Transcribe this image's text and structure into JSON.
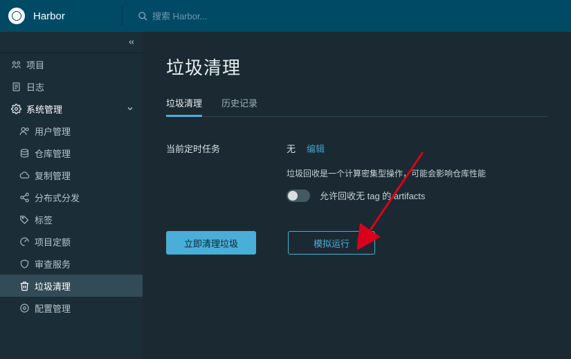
{
  "header": {
    "brand": "Harbor",
    "search_placeholder": "搜索 Harbor..."
  },
  "sidebar": {
    "top": [
      {
        "key": "projects",
        "label": "项目"
      },
      {
        "key": "logs",
        "label": "日志"
      },
      {
        "key": "sysadmin",
        "label": "系统管理",
        "expanded": true
      }
    ],
    "sysadmin_children": [
      {
        "key": "users",
        "label": "用户管理"
      },
      {
        "key": "registries",
        "label": "仓库管理"
      },
      {
        "key": "replication",
        "label": "复制管理"
      },
      {
        "key": "distribution",
        "label": "分布式分发"
      },
      {
        "key": "labels",
        "label": "标签"
      },
      {
        "key": "quotas",
        "label": "项目定额"
      },
      {
        "key": "interrogation",
        "label": "审查服务"
      },
      {
        "key": "gc",
        "label": "垃圾清理",
        "active": true
      },
      {
        "key": "config",
        "label": "配置管理"
      }
    ]
  },
  "main": {
    "title": "垃圾清理",
    "tabs": [
      {
        "key": "gc",
        "label": "垃圾清理",
        "active": true
      },
      {
        "key": "history",
        "label": "历史记录"
      }
    ],
    "schedule_label": "当前定时任务",
    "schedule_value": "无",
    "edit_label": "编辑",
    "note": "垃圾回收是一个计算密集型操作，可能会影响仓库性能",
    "toggle_label": "允许回收无 tag 的 artifacts",
    "toggle_on": false,
    "btn_primary": "立即清理垃圾",
    "btn_outline": "模拟运行"
  }
}
